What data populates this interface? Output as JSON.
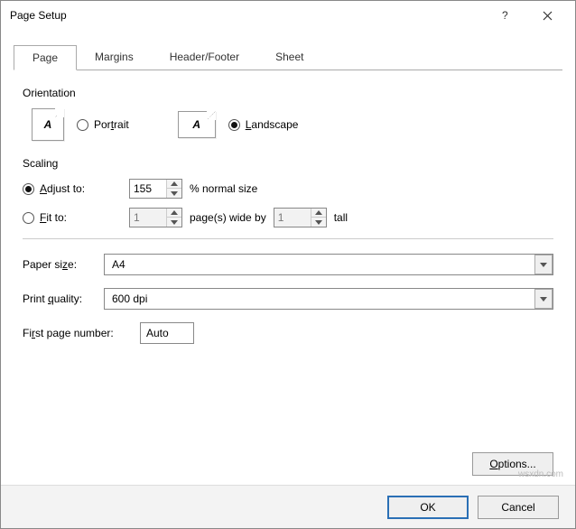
{
  "title": "Page Setup",
  "tabs": {
    "page": "Page",
    "margins": "Margins",
    "header": "Header/Footer",
    "sheet": "Sheet"
  },
  "orientation": {
    "label": "Orientation",
    "portrait": "Portrait",
    "landscape": "Landscape",
    "selected": "landscape",
    "glyph": "A"
  },
  "scaling": {
    "label": "Scaling",
    "adjust_label": "Adjust to:",
    "adjust_value": "155",
    "adjust_suffix": "% normal size",
    "fit_label": "Fit to:",
    "fit_wide": "1",
    "fit_mid": "page(s) wide by",
    "fit_tall": "1",
    "fit_suffix": "tall",
    "selected": "adjust"
  },
  "paper": {
    "label": "Paper size:",
    "value": "A4"
  },
  "quality": {
    "label": "Print quality:",
    "value": "600 dpi"
  },
  "firstpage": {
    "label": "First page number:",
    "value": "Auto"
  },
  "buttons": {
    "options": "Options...",
    "ok": "OK",
    "cancel": "Cancel"
  },
  "watermark": "wsxdn.com"
}
